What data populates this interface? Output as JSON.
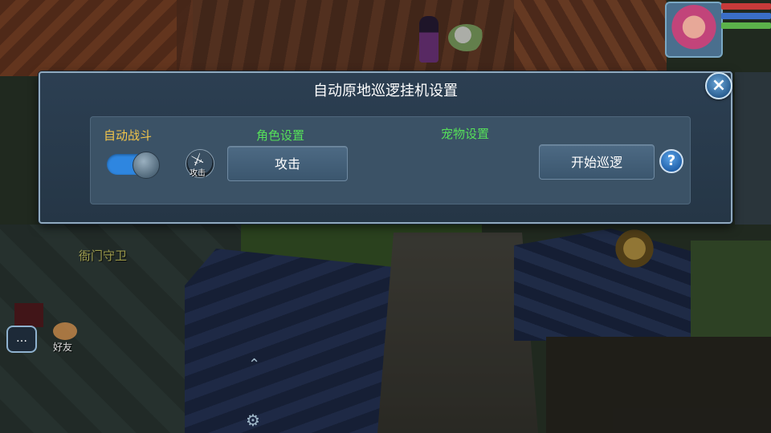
{
  "dialog": {
    "title": "自动原地巡逻挂机设置",
    "close_icon": "close-icon",
    "auto_battle": {
      "label": "自动战斗",
      "enabled": true
    },
    "role_settings": {
      "label": "角色设置",
      "skill_icon": "sword-icon",
      "skill_icon_label": "攻击",
      "skill_button_label": "攻击"
    },
    "pet_settings": {
      "label": "宠物设置"
    },
    "start_button_label": "开始巡逻",
    "help_icon": "question-mark-icon"
  },
  "hud": {
    "npc_label": "衙门守卫",
    "chat_icon": "chat-bubble-icon",
    "friend_label": "好友",
    "expand_icon": "chevron-up-icon",
    "settings_icon": "gear-icon"
  },
  "colors": {
    "title_text": "#ffffff",
    "auto_battle_label": "#f4c64a",
    "section_labels": "#56e05a",
    "toggle_on": "#2e86e0",
    "hp": "#c73a3a",
    "mp": "#3a6ec7",
    "xp": "#5bb24a"
  }
}
